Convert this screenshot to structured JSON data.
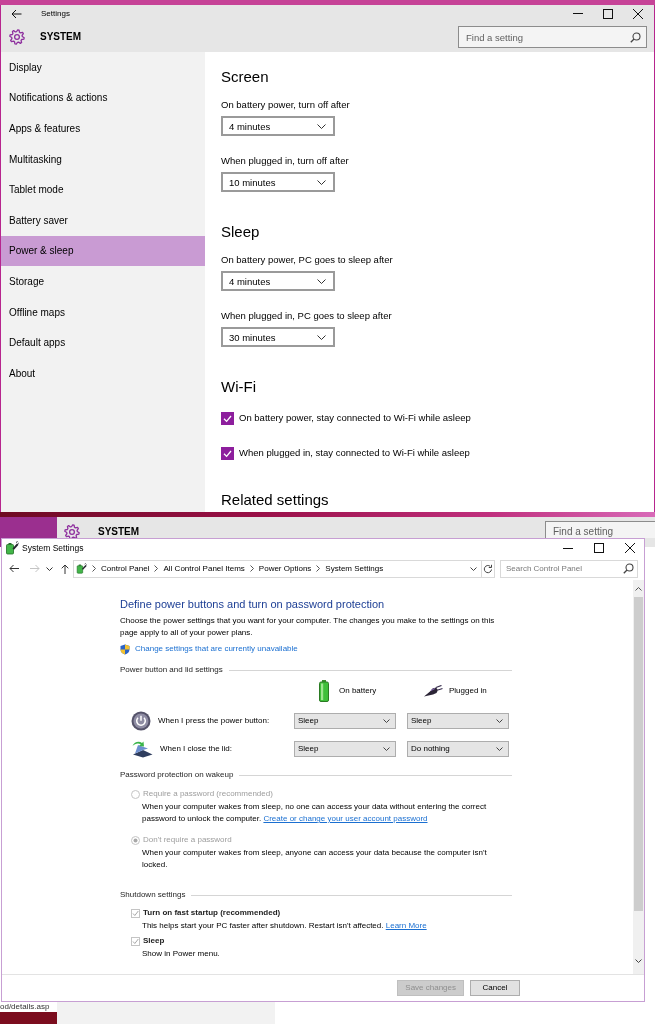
{
  "settings_window": {
    "title": "Settings",
    "header": "SYSTEM",
    "search": {
      "placeholder": "Find a setting"
    },
    "sidebar": {
      "items": [
        {
          "label": "Display",
          "selected": false
        },
        {
          "label": "Notifications & actions",
          "selected": false
        },
        {
          "label": "Apps & features",
          "selected": false
        },
        {
          "label": "Multitasking",
          "selected": false
        },
        {
          "label": "Tablet mode",
          "selected": false
        },
        {
          "label": "Battery saver",
          "selected": false
        },
        {
          "label": "Power & sleep",
          "selected": true
        },
        {
          "label": "Storage",
          "selected": false
        },
        {
          "label": "Offline maps",
          "selected": false
        },
        {
          "label": "Default apps",
          "selected": false
        },
        {
          "label": "About",
          "selected": false
        }
      ]
    },
    "groups": [
      {
        "heading": "Screen",
        "settings": [
          {
            "kind": "dropdown",
            "label": "On battery power, turn off after",
            "value": "4 minutes"
          },
          {
            "kind": "dropdown",
            "label": "When plugged in, turn off after",
            "value": "10 minutes"
          }
        ]
      },
      {
        "heading": "Sleep",
        "settings": [
          {
            "kind": "dropdown",
            "label": "On battery power, PC goes to sleep after",
            "value": "4 minutes"
          },
          {
            "kind": "dropdown",
            "label": "When plugged in, PC goes to sleep after",
            "value": "30 minutes"
          }
        ]
      },
      {
        "heading": "Wi-Fi",
        "settings": [
          {
            "kind": "checkbox",
            "label": "On battery power, stay connected to Wi-Fi while asleep",
            "checked": true
          },
          {
            "kind": "checkbox",
            "label": "When plugged in, stay connected to Wi-Fi while asleep",
            "checked": true
          }
        ]
      },
      {
        "heading": "Related settings"
      }
    ]
  },
  "background_window": {
    "header": "SYSTEM",
    "search": {
      "placeholder": "Find a setting"
    }
  },
  "system_settings_window": {
    "title": "System Settings",
    "navigation": [
      {
        "kind": "back",
        "disabled": false
      },
      {
        "kind": "forward",
        "disabled": true
      },
      {
        "kind": "recent",
        "disabled": false
      },
      {
        "kind": "up",
        "disabled": false
      }
    ],
    "breadcrumb": [
      "Control Panel",
      "All Control Panel Items",
      "Power Options",
      "System Settings"
    ],
    "search": {
      "placeholder": "Search Control Panel"
    },
    "heading": "Define power buttons and turn on password protection",
    "intro": "Choose the power settings that you want for your computer. The changes you make to the settings on this page apply to all of your power plans.",
    "admin_link": "Change settings that are currently unavailable",
    "power_section": {
      "title": "Power button and lid settings",
      "columns": [
        {
          "kind": "battery",
          "label": "On battery"
        },
        {
          "kind": "plugged",
          "label": "Plugged in"
        }
      ],
      "rows": [
        {
          "kind": "power_button",
          "label": "When I press the power button:",
          "values": [
            "Sleep",
            "Sleep"
          ]
        },
        {
          "kind": "lid",
          "label": "When I close the lid:",
          "values": [
            "Sleep",
            "Do nothing"
          ]
        }
      ]
    },
    "password_section": {
      "title": "Password protection on wakeup",
      "options": [
        {
          "label": "Require a password (recommended)",
          "selected": false,
          "disabled": true,
          "description": "When your computer wakes from sleep, no one can access your data without entering the correct password to unlock the computer.",
          "link": "Create or change your user account password"
        },
        {
          "label": "Don't require a password",
          "selected": true,
          "disabled": true,
          "description": "When your computer wakes from sleep, anyone can access your data because the computer isn't locked."
        }
      ]
    },
    "shutdown_section": {
      "title": "Shutdown settings",
      "options": [
        {
          "label": "Turn on fast startup (recommended)",
          "checked": true,
          "disabled": true,
          "description": "This helps start your PC faster after shutdown. Restart isn't affected.",
          "link": "Learn More"
        },
        {
          "label": "Sleep",
          "checked": true,
          "disabled": true,
          "description": "Show in Power menu."
        }
      ]
    },
    "buttons": [
      {
        "kind": "save",
        "label": "Save changes",
        "disabled": true
      },
      {
        "kind": "cancel",
        "label": "Cancel",
        "disabled": false
      }
    ]
  },
  "desktop": {
    "page_address": "od/details.asp"
  }
}
